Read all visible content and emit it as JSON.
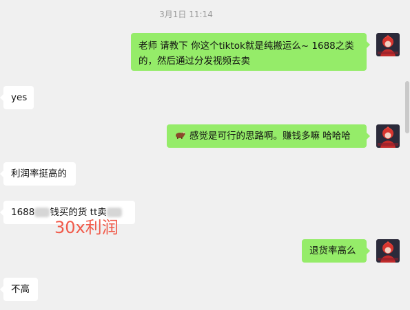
{
  "timestamp": "3月1日 11:14",
  "messages": [
    {
      "id": 1,
      "side": "out",
      "text": "老师 请教下 你这个tiktok就是纯搬运么~ 1688之类的，然后通过分发视频去卖"
    },
    {
      "id": 2,
      "side": "in",
      "text": "yes"
    },
    {
      "id": 3,
      "side": "out",
      "emoji": "bull-emoji",
      "text": "感觉是可行的思路啊。赚钱多嘛 哈哈哈"
    },
    {
      "id": 4,
      "side": "in",
      "text": "利润率挺高的"
    },
    {
      "id": 5,
      "side": "in",
      "text_a": "1688",
      "text_b": "钱买的货 tt卖"
    },
    {
      "id": 6,
      "side": "out",
      "text": "退货率高么"
    },
    {
      "id": 7,
      "side": "in",
      "text": "不高"
    }
  ],
  "annotation": "30x利润",
  "colors": {
    "background": "#f0f0f0",
    "outgoing_bubble": "#95ec69",
    "incoming_bubble": "#ffffff",
    "annotation": "#f15a4a"
  }
}
